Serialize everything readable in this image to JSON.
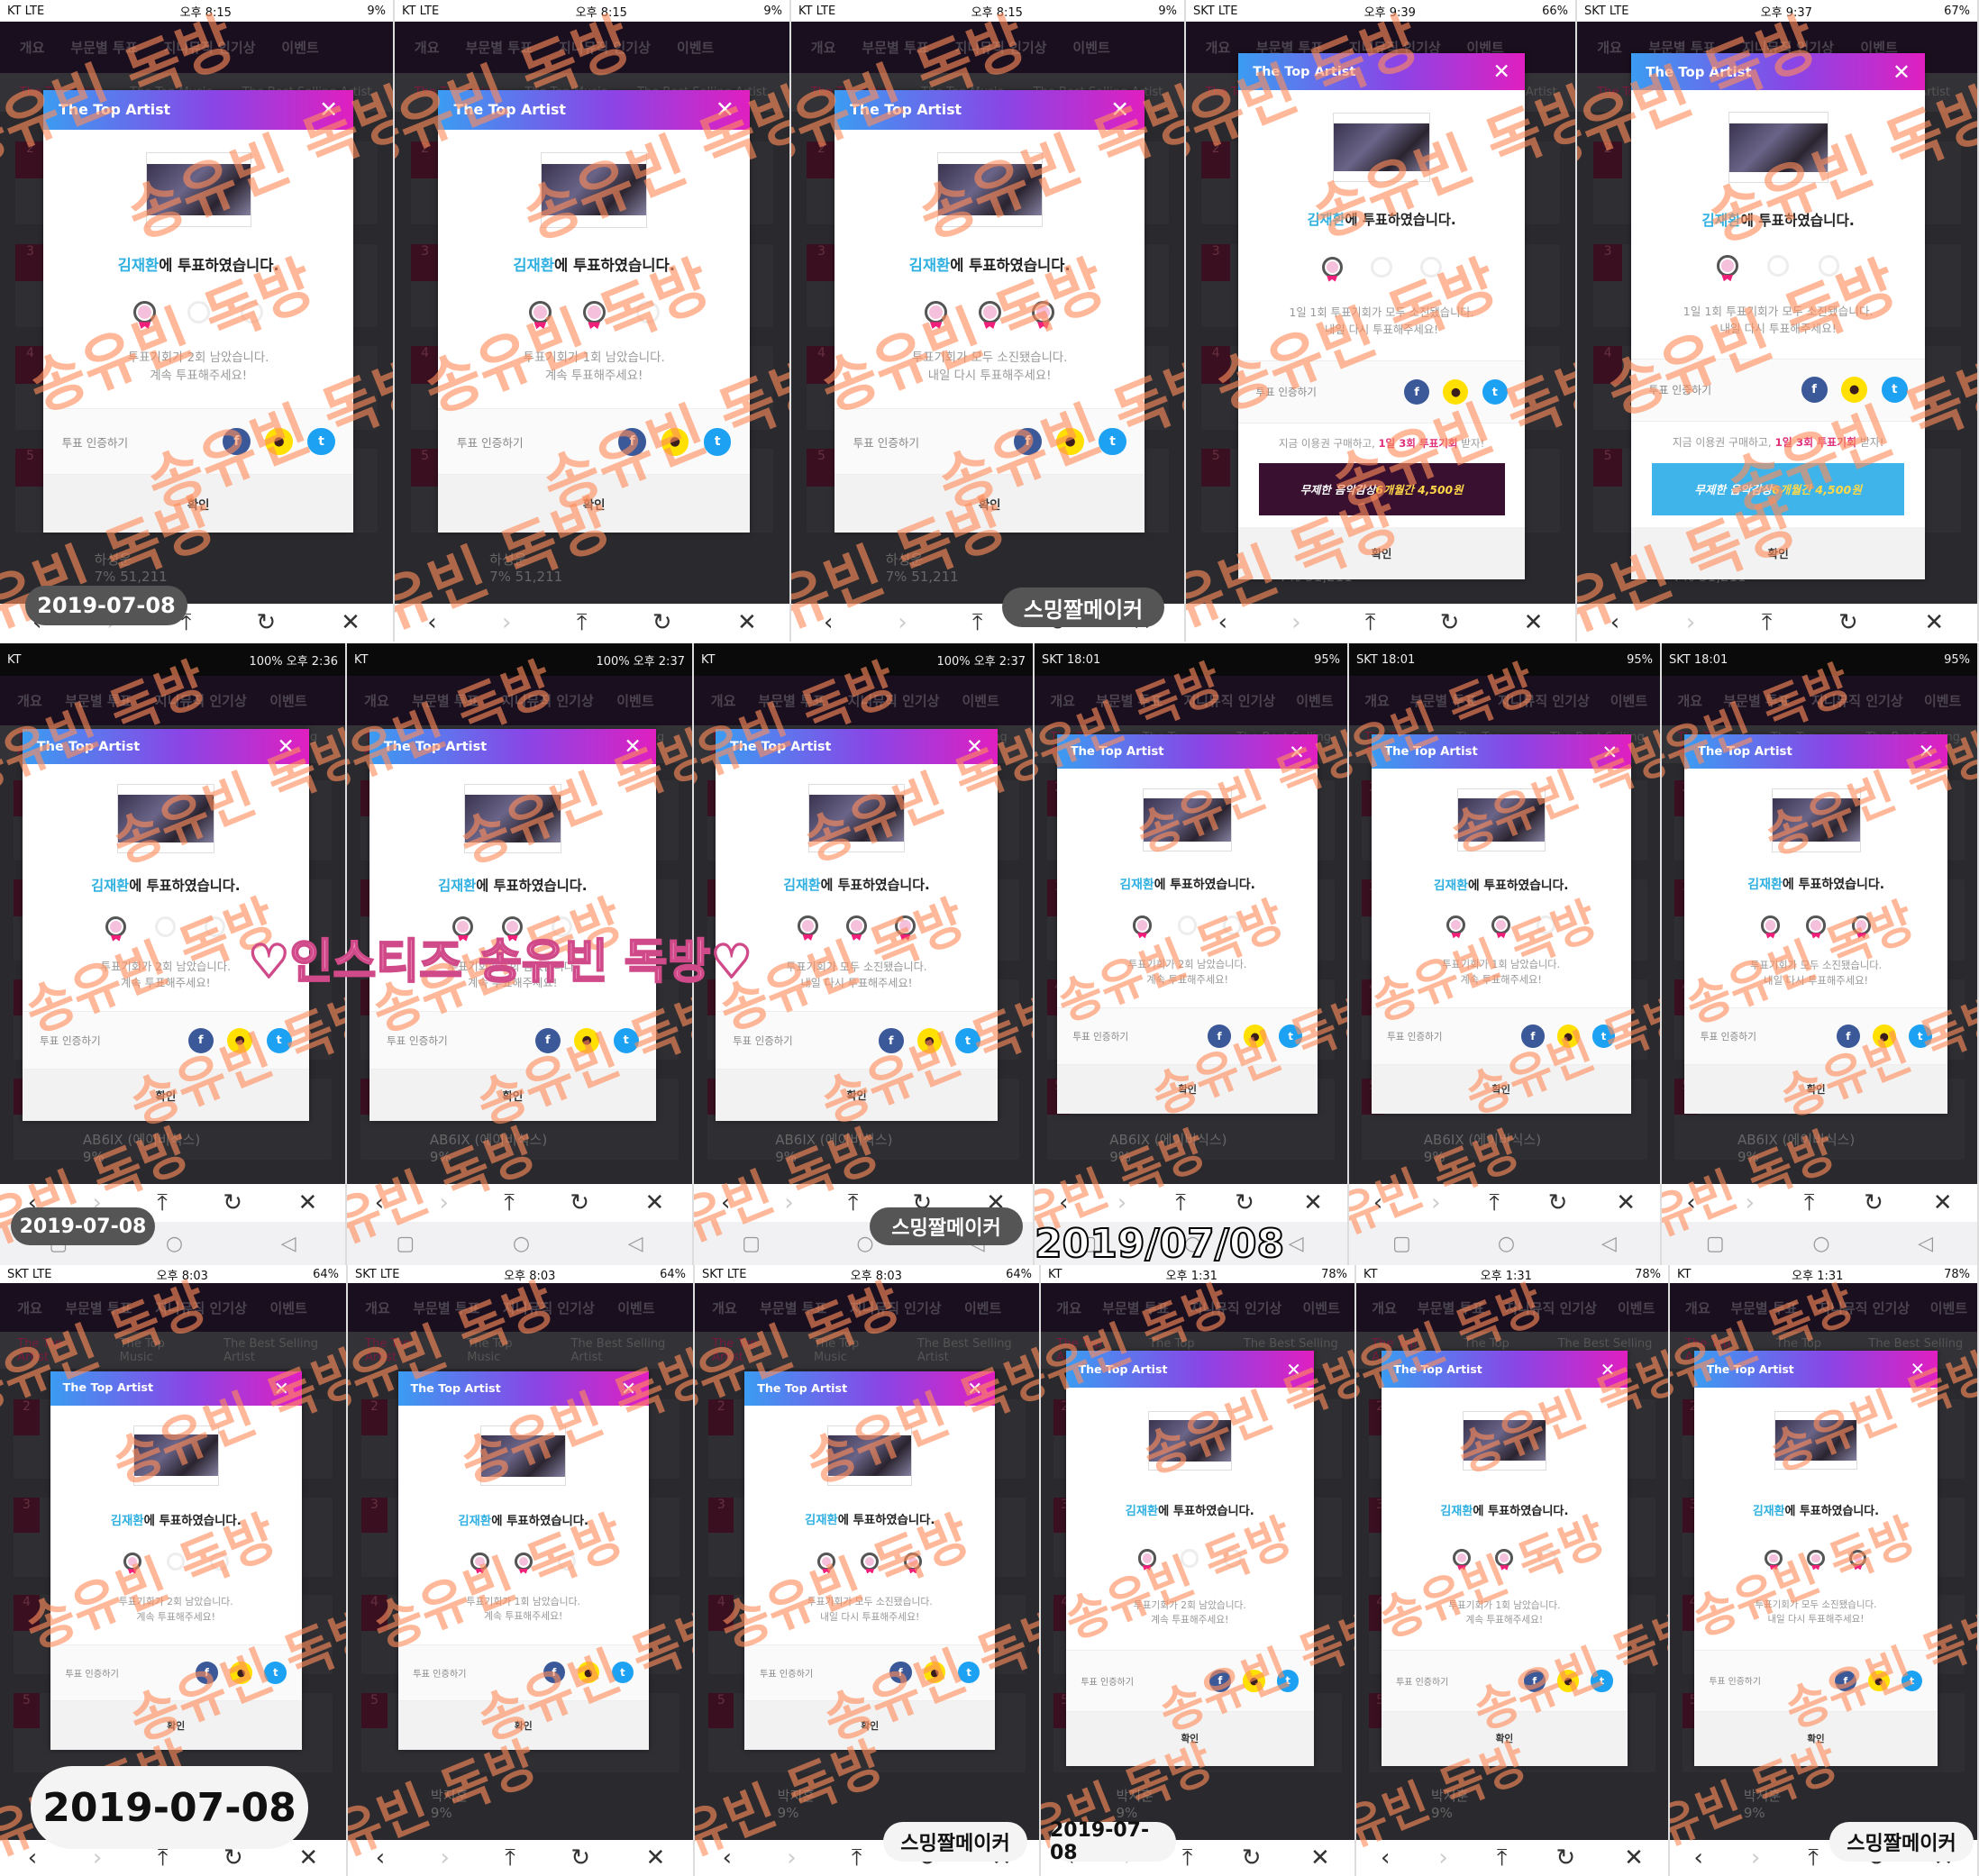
{
  "modal": {
    "title": "The Top Artist",
    "close_icon": "close-icon",
    "artist_name": "김재환",
    "voted_suffix": "에 투표하였습니다.",
    "share_label": "투표 인증하기",
    "confirm_label": "확인",
    "share_buttons": [
      {
        "icon": "facebook-icon",
        "glyph": "f",
        "color": "#3b5998"
      },
      {
        "icon": "kakaotalk-icon",
        "glyph": "●",
        "color": "#ffe000"
      },
      {
        "icon": "twitter-icon",
        "glyph": "t",
        "color": "#1da1f2"
      }
    ],
    "messages": {
      "two_left": [
        "투표기회가 2회 남았습니다.",
        "계속 투표해주세요!"
      ],
      "one_left": [
        "투표기회가 1회 남았습니다.",
        "계속 투표해주세요!"
      ],
      "none_left": [
        "투표기회가 모두 소진됐습니다.",
        "내일 다시 투표해주세요!"
      ],
      "daily_none": [
        "1일 1회 투표기회가 모두 소진됐습니다.",
        "내일 다시 투표해주세요!"
      ]
    },
    "promo": {
      "text_before": "지금 이용권 구매하고, ",
      "text_highlight": "1일 3회 투표기회",
      "text_after": " 받자!",
      "banner_before": "무제한 음악감상 ",
      "banner_highlight": "6개월간 4,500원"
    }
  },
  "app_nav": [
    "개요",
    "부문별 투표",
    "지니뮤직 인기상",
    "이벤트"
  ],
  "sub_tabs": [
    "The Top Artist",
    "The Top Music",
    "The Best Selling Artist"
  ],
  "background_rows": [
    {
      "name": "하성운",
      "percent": "7%",
      "votes": "51,211"
    },
    {
      "name": "AB6IX (에이비식스)",
      "percent": "9%"
    },
    {
      "name": "박지훈",
      "percent": "9%"
    }
  ],
  "watermark": "송유빈 독방",
  "overlay_labels": {
    "date": "2019-07-08",
    "date_alt": "2019/07/08",
    "maker": "스밍짤메이커",
    "insta": "♡인스티즈 송유빈 독방♡"
  },
  "toolbar_icons": [
    "back-icon",
    "forward-icon",
    "share-icon",
    "refresh-icon",
    "close-icon"
  ],
  "panels": [
    {
      "status": [
        "KT  LTE",
        "오후 8:15",
        "9%"
      ],
      "stamps": 1,
      "msg": "two_left",
      "promo": false
    },
    {
      "status": [
        "KT  LTE",
        "오후 8:15",
        "9%"
      ],
      "stamps": 2,
      "msg": "one_left",
      "promo": false
    },
    {
      "status": [
        "KT  LTE",
        "오후 8:15",
        "9%"
      ],
      "stamps": 3,
      "msg": "none_left",
      "promo": false
    },
    {
      "status": [
        "SKT  LTE",
        "오후 9:39",
        "66%"
      ],
      "stamps": 1,
      "msg": "daily_none",
      "promo": true,
      "banner_color": "#3a1030"
    },
    {
      "status": [
        "SKT  LTE",
        "오후 9:37",
        "67%"
      ],
      "stamps": 1,
      "msg": "daily_none",
      "promo": true,
      "banner_color": "#3fb4ea"
    },
    {
      "status": [
        "KT",
        "",
        "100% 오후 2:36"
      ],
      "stamps": 1,
      "msg": "two_left",
      "promo": false
    },
    {
      "status": [
        "KT",
        "",
        "100% 오후 2:37"
      ],
      "stamps": 2,
      "msg": "one_left",
      "promo": false
    },
    {
      "status": [
        "KT",
        "",
        "100% 오후 2:37"
      ],
      "stamps": 3,
      "msg": "none_left",
      "promo": false
    },
    {
      "status": [
        "SKT 18:01",
        "",
        "95%"
      ],
      "stamps": 1,
      "msg": "two_left",
      "promo": false
    },
    {
      "status": [
        "SKT 18:01",
        "",
        "95%"
      ],
      "stamps": 2,
      "msg": "one_left",
      "promo": false
    },
    {
      "status": [
        "SKT 18:01",
        "",
        "95%"
      ],
      "stamps": 3,
      "msg": "none_left",
      "promo": false
    },
    {
      "status": [
        "SKT  LTE",
        "오후 8:03",
        "64%"
      ],
      "stamps": 1,
      "msg": "two_left",
      "promo": false
    },
    {
      "status": [
        "SKT  LTE",
        "오후 8:03",
        "64%"
      ],
      "stamps": 2,
      "msg": "one_left",
      "promo": false
    },
    {
      "status": [
        "SKT  LTE",
        "오후 8:03",
        "64%"
      ],
      "stamps": 3,
      "msg": "none_left",
      "promo": false
    },
    {
      "status": [
        "KT",
        "오후 1:31",
        "78%"
      ],
      "stamps": 1,
      "msg": "two_left",
      "promo": false
    },
    {
      "status": [
        "KT",
        "오후 1:31",
        "78%"
      ],
      "stamps": 2,
      "msg": "one_left",
      "promo": false
    },
    {
      "status": [
        "KT",
        "오후 1:31",
        "78%"
      ],
      "stamps": 3,
      "msg": "none_left",
      "promo": false
    }
  ]
}
